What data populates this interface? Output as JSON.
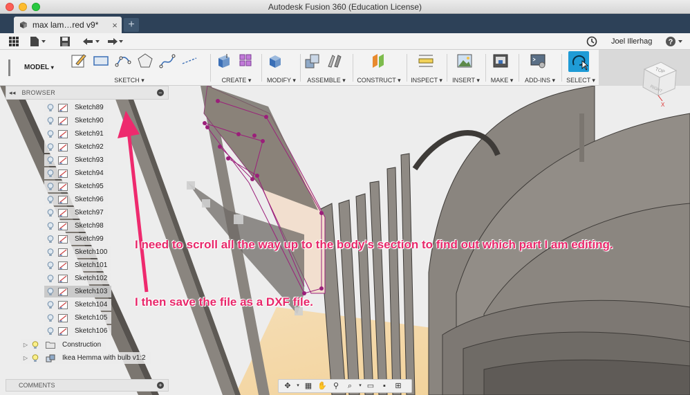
{
  "window": {
    "title": "Autodesk Fusion 360 (Education License)"
  },
  "document_tab": {
    "label": "max lam…red v9*",
    "close_symbol": "×",
    "new_tab_symbol": "+"
  },
  "quick_access": {
    "user_name": "Joel Illerhag",
    "help_symbol": "?"
  },
  "toolbar": {
    "workspace": "MODEL",
    "groups": [
      {
        "label": "SKETCH ▾"
      },
      {
        "label": "CREATE ▾"
      },
      {
        "label": "MODIFY ▾"
      },
      {
        "label": "ASSEMBLE ▾"
      },
      {
        "label": "CONSTRUCT ▾"
      },
      {
        "label": "INSPECT ▾"
      },
      {
        "label": "INSERT ▾"
      },
      {
        "label": "MAKE ▾"
      },
      {
        "label": "ADD-INS ▾"
      },
      {
        "label": "SELECT ▾"
      }
    ]
  },
  "browser": {
    "title": "BROWSER",
    "collapse_symbol": "◂◂",
    "minimize_symbol": "−",
    "sketches": [
      "Sketch89",
      "Sketch90",
      "Sketch91",
      "Sketch92",
      "Sketch93",
      "Sketch94",
      "Sketch95",
      "Sketch96",
      "Sketch97",
      "Sketch98",
      "Sketch99",
      "Sketch100",
      "Sketch101",
      "Sketch102",
      "Sketch103",
      "Sketch104",
      "Sketch105",
      "Sketch106"
    ],
    "selected_sketch": "Sketch103",
    "folders": [
      {
        "label": "Construction"
      },
      {
        "label": "Ikea Hemma with bulb v1:2"
      }
    ]
  },
  "comments": {
    "title": "COMMENTS",
    "add_symbol": "+"
  },
  "view_cube": {
    "face_top": "TOP",
    "face_right": "RIGHT",
    "axis_x": "X"
  },
  "annotations": {
    "line1": "I need to scroll all the way up to the body's section to find out which part I am editing.",
    "line2": "I then save the file as a DXF file."
  },
  "colors": {
    "annotation": "#e8276a",
    "tab_bar": "#2d4158",
    "sketch_line": "#9b1f7a",
    "select_highlight": "#1f9bd6"
  }
}
